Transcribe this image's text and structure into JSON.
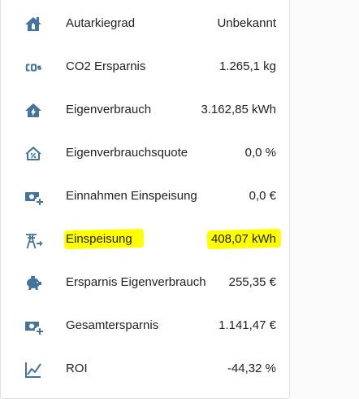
{
  "accent_color": "#44739e",
  "highlight_color": "#ffff00",
  "entities": [
    {
      "icon": "home-battery-icon",
      "name": "Autarkiegrad",
      "value": "Unbekannt"
    },
    {
      "icon": "molecule-co2-icon",
      "name": "CO2 Ersparnis",
      "value": "1.265,1 kg"
    },
    {
      "icon": "home-lightning-icon",
      "name": "Eigenverbrauch",
      "value": "3.162,85 kWh"
    },
    {
      "icon": "home-percent-icon",
      "name": "Eigenverbrauchsquote",
      "value": "0,0 %"
    },
    {
      "icon": "cash-plus-icon",
      "name": "Einnahmen Einspeisung",
      "value": "0,0 €"
    },
    {
      "icon": "transmission-tower-export-icon",
      "name": "Einspeisung",
      "value": "408,07 kWh"
    },
    {
      "icon": "piggy-bank-icon",
      "name": "Ersparnis Eigenverbrauch",
      "value": "255,35 €"
    },
    {
      "icon": "cash-plus-icon",
      "name": "Gesamtersparnis",
      "value": "1.141,47 €"
    },
    {
      "icon": "chart-line-variant-icon",
      "name": "ROI",
      "value": "-44,32 %"
    }
  ]
}
